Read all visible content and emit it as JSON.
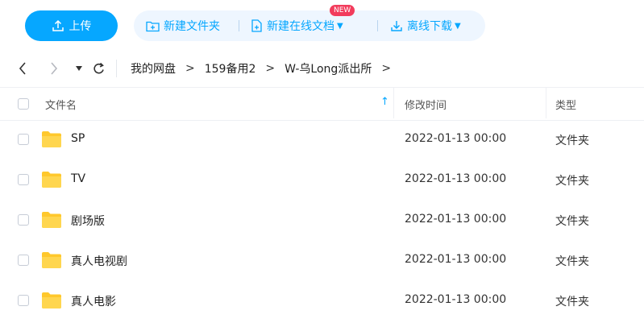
{
  "toolbar": {
    "upload_label": "上传",
    "new_folder_label": "新建文件夹",
    "new_online_doc_label": "新建在线文档",
    "new_badge": "NEW",
    "offline_download_label": "离线下载"
  },
  "breadcrumb": {
    "items": [
      "我的网盘",
      "159备用2",
      "W-乌Long派出所"
    ],
    "separator": ">"
  },
  "table": {
    "columns": {
      "name": "文件名",
      "modified": "修改时间",
      "type": "类型"
    },
    "rows": [
      {
        "name": "SP",
        "modified": "2022-01-13 00:00",
        "type": "文件夹"
      },
      {
        "name": "TV",
        "modified": "2022-01-13 00:00",
        "type": "文件夹"
      },
      {
        "name": "剧场版",
        "modified": "2022-01-13 00:00",
        "type": "文件夹"
      },
      {
        "name": "真人电视剧",
        "modified": "2022-01-13 00:00",
        "type": "文件夹"
      },
      {
        "name": "真人电影",
        "modified": "2022-01-13 00:00",
        "type": "文件夹"
      }
    ]
  },
  "colors": {
    "accent": "#06a7ff",
    "badge": "#f23c5c",
    "folder": "#ffc82c"
  }
}
